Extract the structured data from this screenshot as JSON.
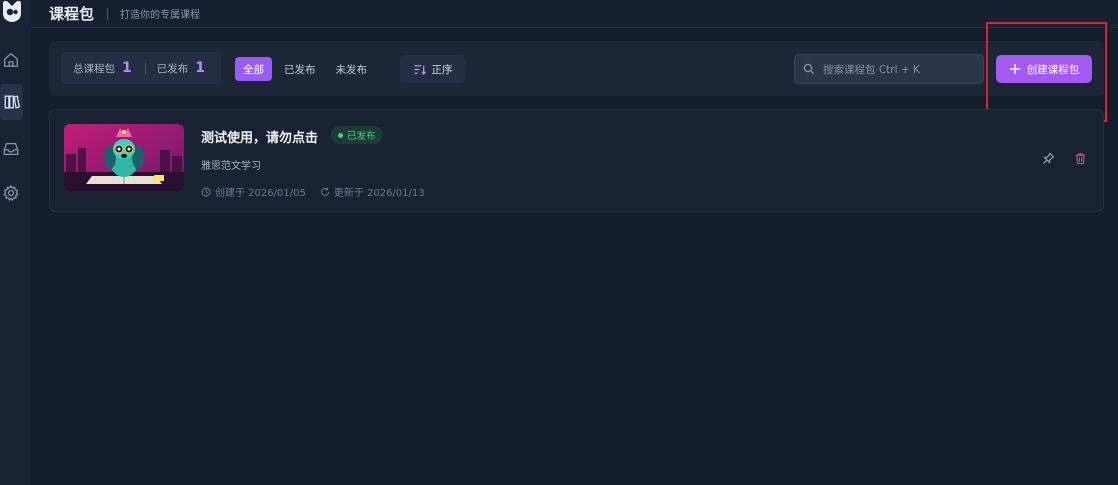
{
  "header": {
    "title": "课程包",
    "subtitle": "打造你的专属课程"
  },
  "sidebar": {
    "items": [
      {
        "name": "home",
        "icon": "home-icon"
      },
      {
        "name": "courses",
        "icon": "books-icon",
        "active": true
      },
      {
        "name": "inbox",
        "icon": "inbox-icon"
      },
      {
        "name": "settings",
        "icon": "gear-icon"
      }
    ]
  },
  "stats": {
    "total_label": "总课程包",
    "total_value": "1",
    "published_label": "已发布",
    "published_value": "1"
  },
  "filters": {
    "all": "全部",
    "published": "已发布",
    "unpublished": "未发布",
    "active": "全部"
  },
  "sort": {
    "label": "正序"
  },
  "search": {
    "placeholder": "搜索课程包 Ctrl + K"
  },
  "create": {
    "label": "创建课程包"
  },
  "courses": [
    {
      "title": "测试使用，请勿点击",
      "status": "已发布",
      "description": "雅思范文学习",
      "created": "创建于 2026/01/05",
      "updated": "更新于 2026/01/13"
    }
  ],
  "colors": {
    "accent": "#9b5cf6",
    "status_green": "#3ecf8e",
    "delete_red": "#e25555",
    "highlight": "#d6262b"
  }
}
